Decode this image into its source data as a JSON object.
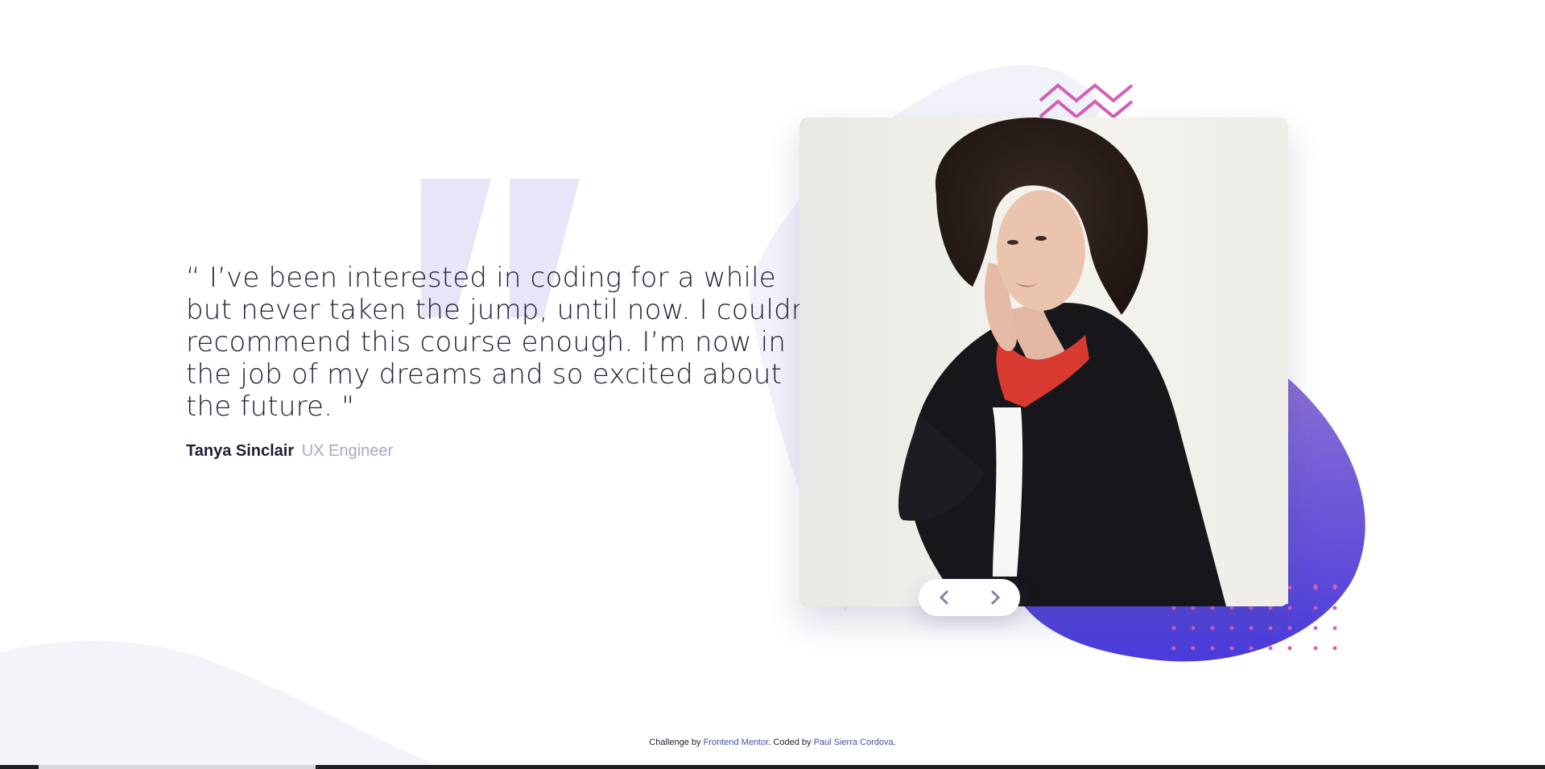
{
  "testimonial": {
    "quote": "“ I’ve been interested in coding for a while but never taken the jump, until now. I couldn’t recommend this course enough. I’m now in the job of my dreams and so excited about the future. \"",
    "author_name": "Tanya Sinclair",
    "author_role": "UX Engineer",
    "photo_alt": "Tanya Sinclair"
  },
  "navigation": {
    "prev_icon": "chevron-left-icon",
    "next_icon": "chevron-right-icon"
  },
  "footer": {
    "prefix": "Challenge by ",
    "challenge_link": "Frontend Mentor",
    "middle": ". Coded by ",
    "author_link": "Paul Sierra Cordova",
    "suffix": "."
  },
  "colors": {
    "text_dark": "#202036",
    "text_muted": "#a8a8c8",
    "blob_gradient_start": "#8a6fd6",
    "blob_gradient_end": "#4a3bdb",
    "pink_accent": "#d161b4",
    "quote_mark": "#e7e5f8",
    "bg_curve": "#f3f3fa"
  }
}
